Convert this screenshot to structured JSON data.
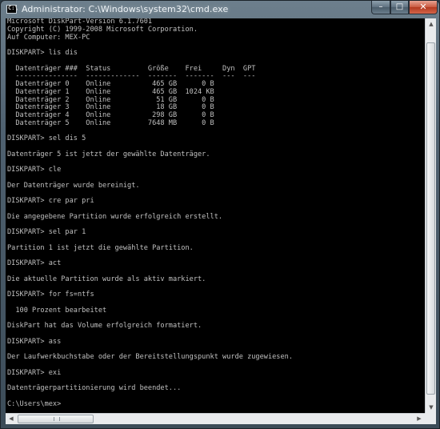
{
  "window": {
    "title": "Administrator: C:\\Windows\\system32\\cmd.exe",
    "icon": "cmd-icon",
    "icon_glyph": "C:\\",
    "controls": {
      "minimize": "–",
      "maximize": "□",
      "close": "✕"
    }
  },
  "console": {
    "lines": [
      "Microsoft DiskPart-Version 6.1.7601",
      "Copyright (C) 1999-2008 Microsoft Corporation.",
      "Auf Computer: MEX-PC",
      "",
      "DISKPART> lis dis",
      "",
      "  Datenträger ###  Status         Größe    Frei     Dyn  GPT",
      "  ---------------  -------------  -------  -------  ---  ---",
      "  Datenträger 0    Online          465 GB      0 B",
      "  Datenträger 1    Online          465 GB  1024 KB",
      "  Datenträger 2    Online           51 GB      0 B",
      "  Datenträger 3    Online           18 GB      0 B",
      "  Datenträger 4    Online          298 GB      0 B",
      "  Datenträger 5    Online         7648 MB      0 B",
      "",
      "DISKPART> sel dis 5",
      "",
      "Datenträger 5 ist jetzt der gewählte Datenträger.",
      "",
      "DISKPART> cle",
      "",
      "Der Datenträger wurde bereinigt.",
      "",
      "DISKPART> cre par pri",
      "",
      "Die angegebene Partition wurde erfolgreich erstellt.",
      "",
      "DISKPART> sel par 1",
      "",
      "Partition 1 ist jetzt die gewählte Partition.",
      "",
      "DISKPART> act",
      "",
      "Die aktuelle Partition wurde als aktiv markiert.",
      "",
      "DISKPART> for fs=ntfs",
      "",
      "  100 Prozent bearbeitet",
      "",
      "DiskPart hat das Volume erfolgreich formatiert.",
      "",
      "DISKPART> ass",
      "",
      "Der Laufwerkbuchstabe oder der Bereitstellungspunkt wurde zugewiesen.",
      "",
      "DISKPART> exi",
      "",
      "Datenträgerpartitionierung wird beendet...",
      "",
      "C:\\Users\\mex>"
    ]
  },
  "colors": {
    "console_bg": "#000000",
    "console_fg": "#c0c0c0",
    "close_button": "#c9593f"
  }
}
